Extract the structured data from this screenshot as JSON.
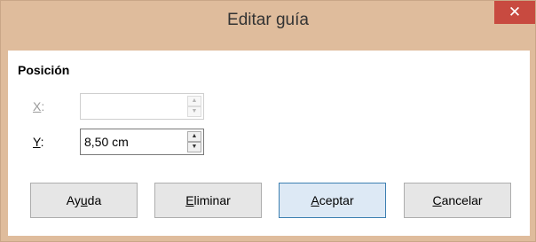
{
  "window": {
    "title": "Editar guía",
    "close_glyph": "✕"
  },
  "position": {
    "section_label": "Posición",
    "x": {
      "label_accel": "X",
      "label_rest": ":",
      "value": "",
      "enabled": false
    },
    "y": {
      "label_accel": "Y",
      "label_rest": ":",
      "value": "8,50 cm",
      "enabled": true
    }
  },
  "buttons": {
    "help": {
      "pre": "Ay",
      "accel": "u",
      "post": "da"
    },
    "delete": {
      "pre": "",
      "accel": "E",
      "post": "liminar"
    },
    "ok": {
      "pre": "",
      "accel": "A",
      "post": "ceptar"
    },
    "cancel": {
      "pre": "",
      "accel": "C",
      "post": "ancelar"
    }
  },
  "icons": {
    "spin_up": "▲",
    "spin_down": "▼"
  },
  "colors": {
    "titlebar": "#dfbc9c",
    "close_button": "#c84a40",
    "default_button_border": "#3c7fb1"
  }
}
